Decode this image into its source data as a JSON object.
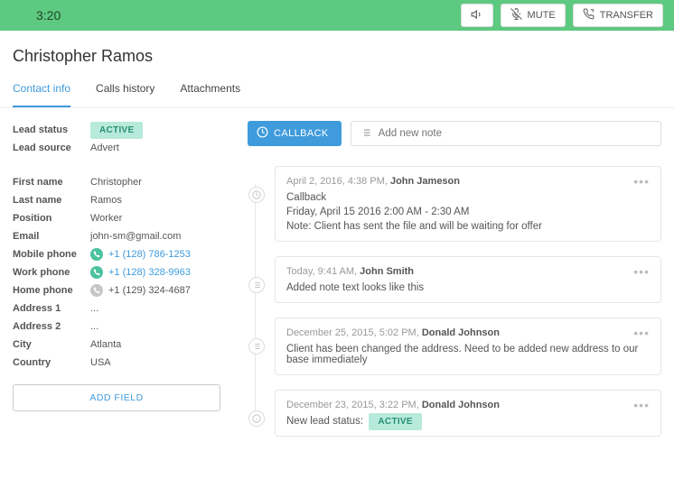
{
  "call": {
    "timer": "3:20",
    "mute_label": "MUTE",
    "transfer_label": "TRANSFER"
  },
  "lead": {
    "name": "Christopher Ramos"
  },
  "tabs": {
    "contact": "Contact info",
    "calls": "Calls history",
    "attachments": "Attachments"
  },
  "fields": {
    "labels": {
      "lead_status": "Lead status",
      "lead_source": "Lead source",
      "first_name": "First name",
      "last_name": "Last name",
      "position": "Position",
      "email": "Email",
      "mobile_phone": "Mobile phone",
      "work_phone": "Work phone",
      "home_phone": "Home phone",
      "address1": "Address 1",
      "address2": "Address 2",
      "city": "City",
      "country": "Country"
    },
    "values": {
      "lead_status": "ACTIVE",
      "lead_source": "Advert",
      "first_name": "Christopher",
      "last_name": "Ramos",
      "position": "Worker",
      "email": "john-sm@gmail.com",
      "mobile_phone": "+1 (128) 786-1253",
      "work_phone": "+1 (128) 328-9963",
      "home_phone": "+1 (129) 324-4687",
      "address1": "...",
      "address2": "...",
      "city": "Atlanta",
      "country": "USA"
    }
  },
  "buttons": {
    "add_field": "ADD FIELD",
    "callback": "CALLBACK"
  },
  "notes": {
    "placeholder": "Add new note"
  },
  "timeline": [
    {
      "date": "April 2, 2016, 4:38 PM,",
      "author": "John Jameson",
      "type": "callback",
      "lines": [
        "Callback",
        "Friday, April 15 2016 2:00 AM - 2:30 AM",
        "Note: Client has sent the file and will be waiting for offer"
      ]
    },
    {
      "date": "Today, 9:41 AM,",
      "author": "John Smith",
      "type": "note",
      "lines": [
        "Added note text looks like this"
      ]
    },
    {
      "date": "December 25, 2015, 5:02 PM,",
      "author": "Donald Johnson",
      "type": "note",
      "lines": [
        "Client has been changed the address. Need to be added new address to our base immediately"
      ]
    },
    {
      "date": "December 23, 2015, 3:22 PM,",
      "author": "Donald Johnson",
      "type": "status",
      "status_label": "New lead status:",
      "status_value": "ACTIVE"
    }
  ]
}
